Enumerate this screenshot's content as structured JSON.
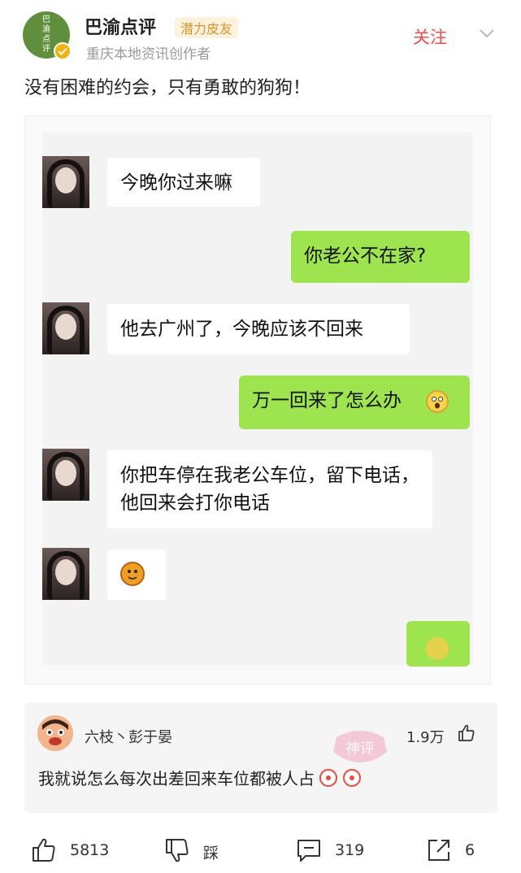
{
  "author": {
    "name": "巴渝点评",
    "badge": "潜力皮友",
    "description": "重庆本地资讯创作者",
    "logo_chars": [
      "巴",
      "渝",
      "点",
      "评"
    ],
    "follow_label": "关注"
  },
  "post": {
    "title": "没有困难的约会，只有勇敢的狗狗！"
  },
  "chat": {
    "messages": [
      {
        "side": "left",
        "text": "今晚你过来嘛"
      },
      {
        "side": "right",
        "text": "你老公不在家?"
      },
      {
        "side": "left",
        "text": "他去广州了，今晚应该不回来"
      },
      {
        "side": "right",
        "text": "万一回来了怎么办"
      },
      {
        "side": "left",
        "text": "你把车停在我老公车位，留下电话，他回来会打你电话"
      },
      {
        "side": "left",
        "emoji": "tiger-emoji"
      },
      {
        "side": "right",
        "emoji": "dog-emoji"
      }
    ]
  },
  "comment": {
    "user": "六枝丶彭于晏",
    "likes": "1.9万",
    "text": "我就说怎么每次出差回来车位都被人占",
    "watermark": "神评"
  },
  "actions": {
    "like_count": "5813",
    "dislike_label": "踩",
    "comment_count": "319",
    "share_count": "6"
  },
  "colors": {
    "accent_red": "#f04b4b",
    "bubble_green": "#9ee44f",
    "badge_text": "#d9932b"
  }
}
